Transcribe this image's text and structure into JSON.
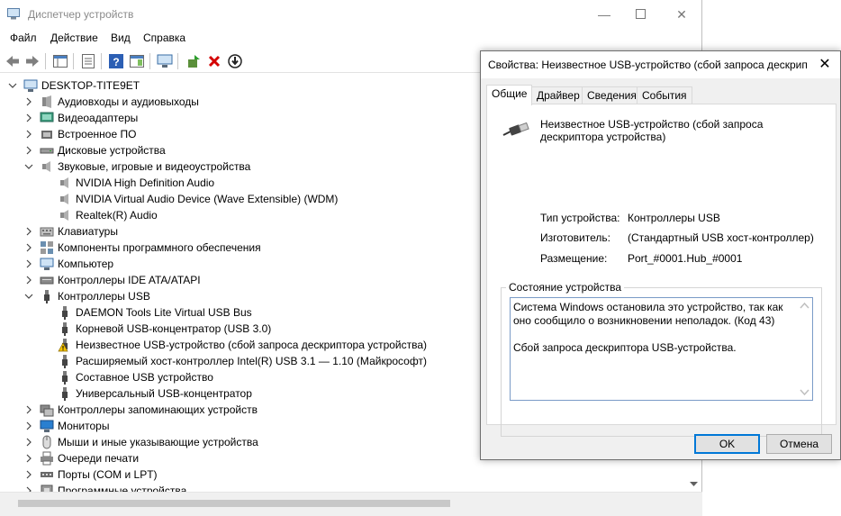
{
  "window": {
    "title": "Диспетчер устройств",
    "menu": [
      "Файл",
      "Действие",
      "Вид",
      "Справка"
    ]
  },
  "tree": {
    "root": "DESKTOP-TITE9ET",
    "items": [
      {
        "label": "Аудиовходы и аудиовыходы",
        "icon": "audio-io-icon"
      },
      {
        "label": "Видеоадаптеры",
        "icon": "display-adapter-icon"
      },
      {
        "label": "Встроенное ПО",
        "icon": "firmware-icon"
      },
      {
        "label": "Дисковые устройства",
        "icon": "disk-drive-icon"
      },
      {
        "label": "Звуковые, игровые и видеоустройства",
        "icon": "speaker-icon",
        "expanded": true
      },
      {
        "label": "NVIDIA High Definition Audio",
        "icon": "speaker-icon",
        "child": true
      },
      {
        "label": "NVIDIA Virtual Audio Device (Wave Extensible) (WDM)",
        "icon": "speaker-icon",
        "child": true
      },
      {
        "label": "Realtek(R) Audio",
        "icon": "speaker-icon",
        "child": true
      },
      {
        "label": "Клавиатуры",
        "icon": "keyboard-icon"
      },
      {
        "label": "Компоненты программного обеспечения",
        "icon": "software-component-icon"
      },
      {
        "label": "Компьютер",
        "icon": "computer-icon"
      },
      {
        "label": "Контроллеры IDE ATA/ATAPI",
        "icon": "ide-controller-icon"
      },
      {
        "label": "Контроллеры USB",
        "icon": "usb-icon",
        "expanded": true
      },
      {
        "label": "DAEMON Tools Lite Virtual USB Bus",
        "icon": "usb-icon",
        "child": true
      },
      {
        "label": "Корневой USB-концентратор (USB 3.0)",
        "icon": "usb-icon",
        "child": true
      },
      {
        "label": "Неизвестное USB-устройство (сбой запроса дескриптора устройства)",
        "icon": "warning-icon",
        "child": true
      },
      {
        "label": "Расширяемый хост-контроллер Intel(R) USB 3.1 — 1.10 (Майкрософт)",
        "icon": "usb-icon",
        "child": true
      },
      {
        "label": "Составное USB устройство",
        "icon": "usb-icon",
        "child": true
      },
      {
        "label": "Универсальный USB-концентратор",
        "icon": "usb-icon",
        "child": true
      },
      {
        "label": "Контроллеры запоминающих устройств",
        "icon": "storage-controller-icon"
      },
      {
        "label": "Мониторы",
        "icon": "monitor-icon"
      },
      {
        "label": "Мыши и иные указывающие устройства",
        "icon": "mouse-icon"
      },
      {
        "label": "Очереди печати",
        "icon": "printer-icon"
      },
      {
        "label": "Порты (COM и LPT)",
        "icon": "port-icon"
      },
      {
        "label": "Программные устройства",
        "icon": "software-device-icon"
      }
    ]
  },
  "dialog": {
    "title": "Свойства: Неизвестное USB-устройство (сбой запроса дескрип",
    "tabs": [
      "Общие",
      "Драйвер",
      "Сведения",
      "События"
    ],
    "device_name": "Неизвестное USB-устройство (сбой запроса дескриптора устройства)",
    "props": [
      {
        "key": "Тип устройства:",
        "value": "Контроллеры USB"
      },
      {
        "key": "Изготовитель:",
        "value": "(Стандартный USB хост-контроллер)"
      },
      {
        "key": "Размещение:",
        "value": "Port_#0001.Hub_#0001"
      }
    ],
    "status_label": "Состояние устройства",
    "status_text": "Система Windows остановила это устройство, так как оно сообщило о возникновении неполадок. (Код 43)\n\nСбой запроса дескриптора USB-устройства.",
    "ok": "OK",
    "cancel": "Отмена"
  },
  "colors": {
    "accent": "#0078d7",
    "warning": "#f5c400",
    "delete": "#d40000"
  }
}
